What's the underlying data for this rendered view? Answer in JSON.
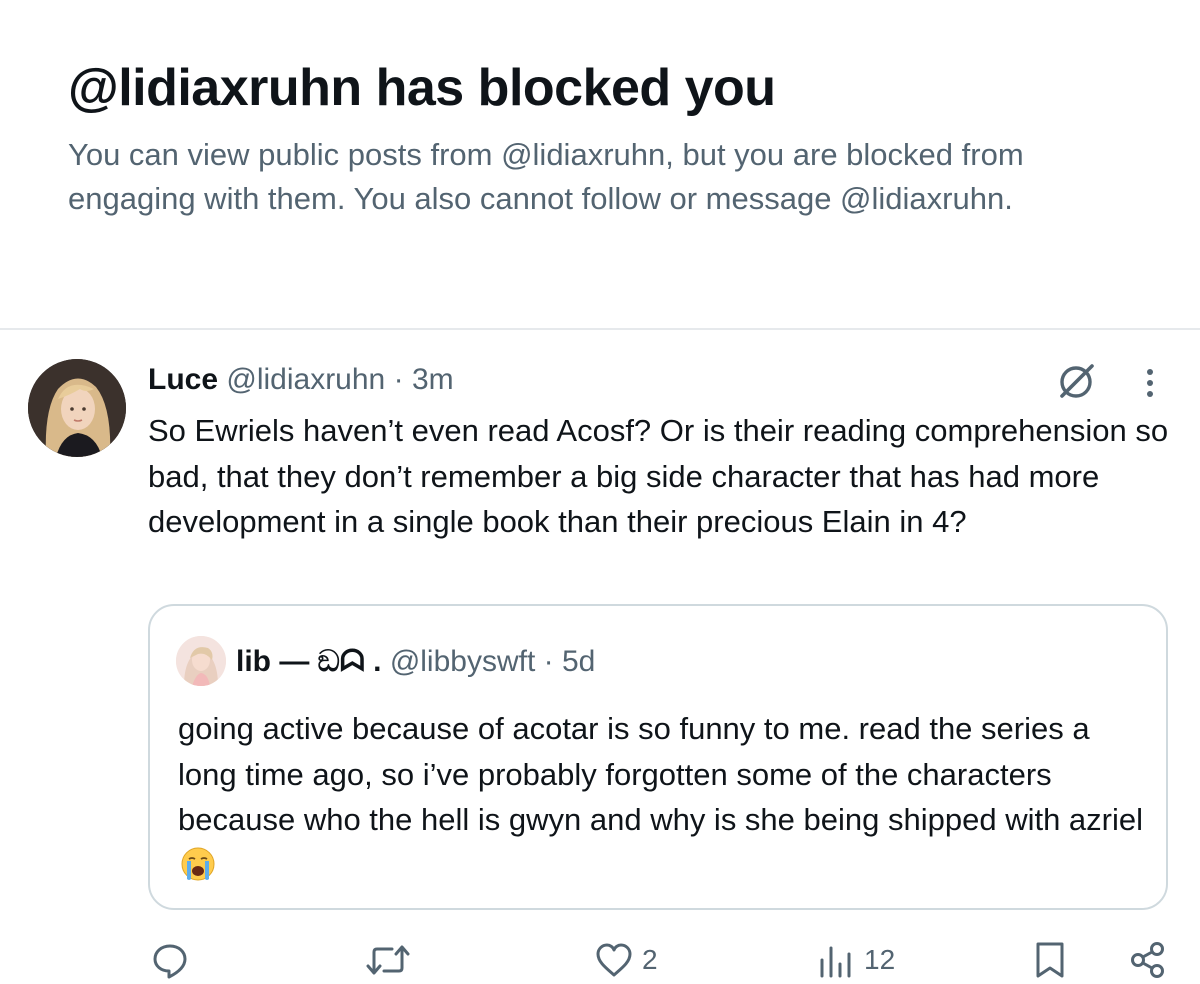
{
  "blocked_notice": {
    "title": "@lidiaxruhn has blocked you",
    "description": "You can view public posts from @lidiaxruhn, but you are blocked from engaging with them. You also cannot follow or message @lidiaxruhn."
  },
  "post": {
    "author_name": "Luce",
    "author_handle": "@lidiaxruhn",
    "separator": "·",
    "time": "3m",
    "text": "So Ewriels haven’t even read Acosf? Or is their reading comprehension so bad, that they don’t remember a big side character that has had more development in a single book than their precious Elain in 4?",
    "quoted": {
      "author_name": "lib — ඞᗣ .",
      "author_handle": "@libbyswft",
      "separator": "·",
      "time": "5d",
      "text": "going active because of acotar is so funny to me. read the series a long time ago, so i’ve probably forgotten some of the characters because who the hell is gwyn and why is she being shipped with azriel",
      "emoji": "loudly-crying-face"
    },
    "actions": {
      "reply_count": "",
      "repost_count": "",
      "like_count": "2",
      "views_count": "12"
    }
  },
  "icons": [
    "grok-icon",
    "more-dots-icon",
    "reply-icon",
    "repost-icon",
    "like-icon",
    "views-icon",
    "bookmark-icon",
    "share-icon"
  ],
  "colors": {
    "primary_text": "#0f1419",
    "secondary_text": "#536471",
    "border": "#cfd9de"
  }
}
